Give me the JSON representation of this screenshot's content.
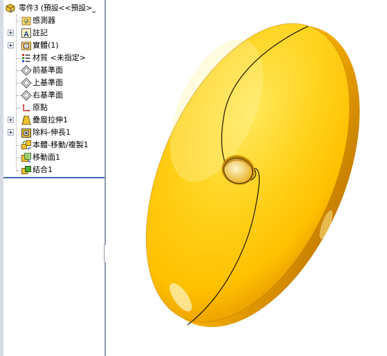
{
  "feature_tree": {
    "root": {
      "label": "零件3 (預設<<預設>_",
      "icon": "part-icon"
    },
    "items": [
      {
        "label": "感測器",
        "icon": "sensor-folder-icon",
        "expandable": false
      },
      {
        "label": "註記",
        "icon": "annotations-icon",
        "expandable": true
      },
      {
        "label": "實體(1)",
        "icon": "solid-bodies-icon",
        "expandable": true
      },
      {
        "label": "材質 <未指定>",
        "icon": "material-icon",
        "expandable": false
      },
      {
        "label": "前基準面",
        "icon": "plane-icon",
        "expandable": false
      },
      {
        "label": "上基準面",
        "icon": "plane-icon",
        "expandable": false
      },
      {
        "label": "右基準面",
        "icon": "plane-icon",
        "expandable": false
      },
      {
        "label": "原點",
        "icon": "origin-icon",
        "expandable": false
      },
      {
        "label": "疊層拉伸1",
        "icon": "loft-icon",
        "expandable": true
      },
      {
        "label": "除料-伸長1",
        "icon": "cut-extrude-icon",
        "expandable": true
      },
      {
        "label": "本體-移動/複製1",
        "icon": "move-copy-body-icon",
        "expandable": false
      },
      {
        "label": "移動面1",
        "icon": "move-face-icon",
        "expandable": false
      },
      {
        "label": "結合1",
        "icon": "combine-icon",
        "expandable": false
      }
    ]
  },
  "viewport": {
    "model": "yellow-oval-solid",
    "colors": {
      "body_light": "#ffe85a",
      "body_mid": "#ffc80a",
      "body_dark": "#e89a00",
      "edge": "#3a2a00",
      "splitter": "#8c96a8",
      "divider": "#3c6dbe"
    }
  }
}
